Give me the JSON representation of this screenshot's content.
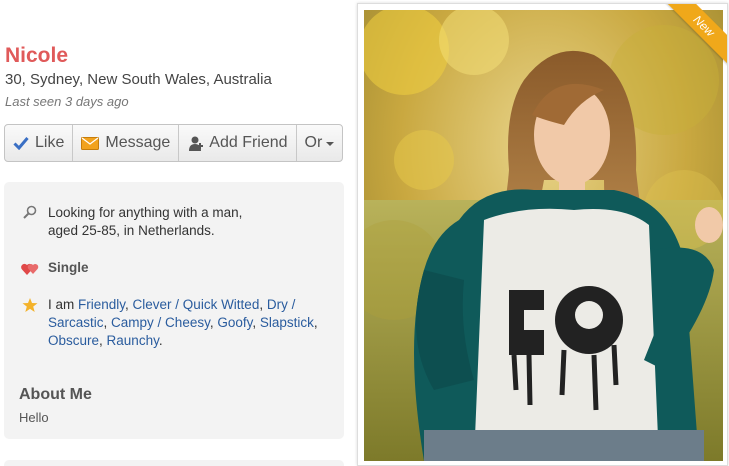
{
  "profile": {
    "name": "Nicole",
    "location": "30, Sydney, New South Wales, Australia",
    "last_seen": "Last seen 3 days ago"
  },
  "actions": {
    "like": "Like",
    "message": "Message",
    "add_friend": "Add Friend",
    "or": "Or"
  },
  "details": {
    "looking_line1": "Looking for anything with a man,",
    "looking_line2": "aged 25-85, in Netherlands.",
    "status": "Single",
    "traits_prefix": "I am ",
    "traits": [
      "Friendly",
      "Clever / Quick Witted",
      "Dry / Sarcastic",
      "Campy / Cheesy",
      "Goofy",
      "Slapstick",
      "Obscure",
      "Raunchy"
    ],
    "traits_end": "."
  },
  "about": {
    "heading": "About Me",
    "text": "Hello"
  },
  "photo": {
    "badge": "New"
  },
  "colors": {
    "name": "#e05a5a",
    "link": "#2a5c9e",
    "badge": "#f0a81a",
    "heart": "#e04848",
    "star": "#f3b22a",
    "check": "#3a6fc4"
  }
}
